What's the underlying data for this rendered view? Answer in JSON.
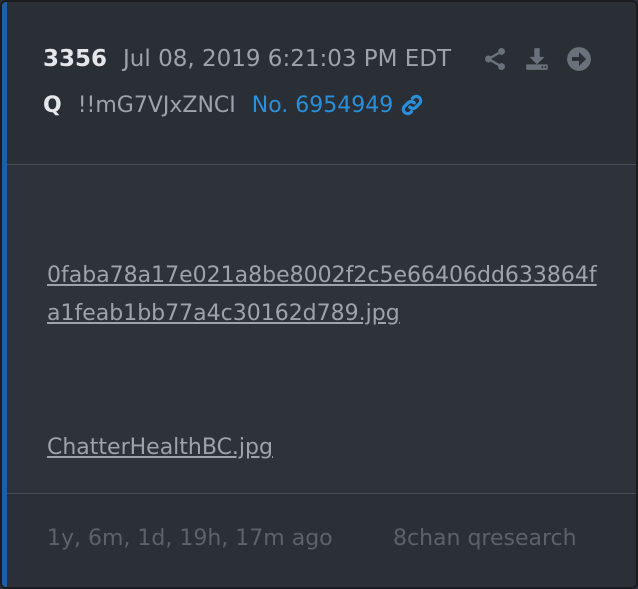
{
  "post": {
    "number": "3356",
    "timestamp": "Jul 08, 2019 6:21:03 PM EDT",
    "author": "Q",
    "tripcode": "!!mG7VJxZNCI",
    "post_link": "No. 6954949",
    "actions": {
      "share_icon": "share-icon",
      "download_icon": "download-icon",
      "goto_icon": "arrow-circle-right-icon"
    },
    "link_icon": "link-icon"
  },
  "files": [
    {
      "name": "0faba78a17e021a8be8002f2c5e66406dd633864fa1feab1bb77a4c30162d789.jpg"
    },
    {
      "name": "ChatterHealthBC.jpg"
    }
  ],
  "footer": {
    "age": "1y, 6m, 1d, 19h, 17m ago",
    "source": "8chan qresearch"
  },
  "colors": {
    "accent": "#1f5fa8",
    "link": "#2b8fd8",
    "background": "#2e323b",
    "muted_text": "#9ea3ab"
  }
}
